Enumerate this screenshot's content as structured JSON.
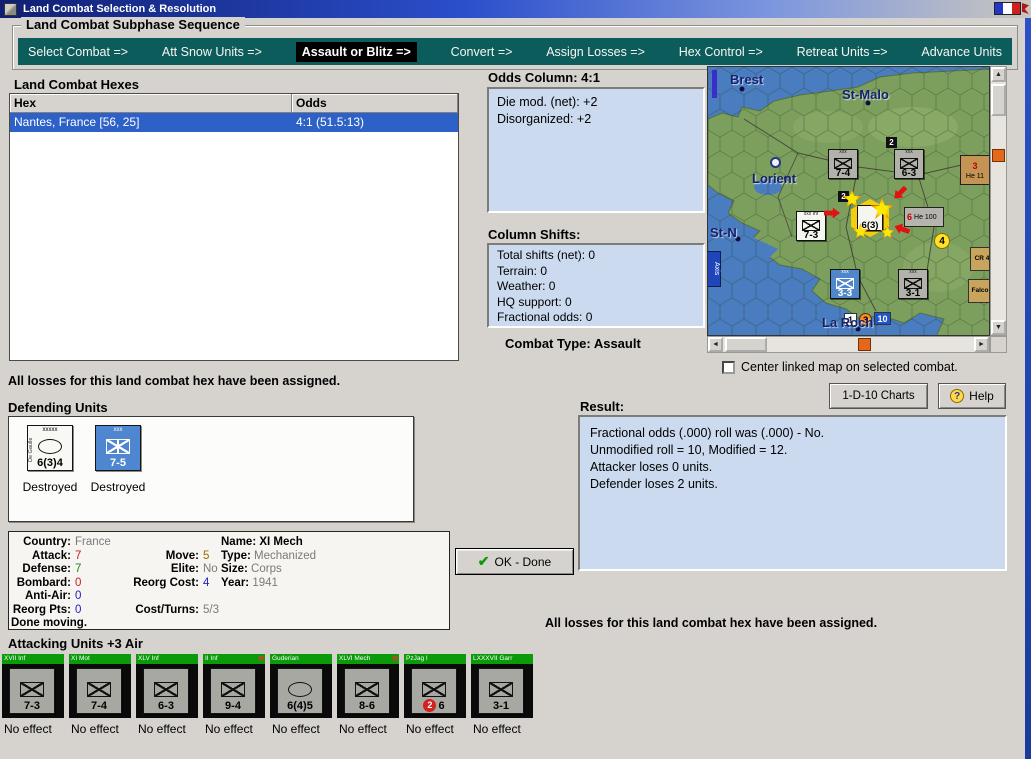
{
  "window": {
    "title": "Land Combat Selection & Resolution"
  },
  "glyphs": {
    "up": "▲",
    "down": "▼",
    "left": "◄",
    "right": "►",
    "help": "?"
  },
  "sequence": {
    "title": "Land Combat Subphase Sequence",
    "steps": [
      "Select Combat =>",
      "Att Snow Units =>",
      "Assault or Blitz =>",
      "Convert =>",
      "Assign Losses =>",
      "Hex Control =>",
      "Retreat Units =>",
      "Advance Units"
    ]
  },
  "hexes": {
    "title": "Land Combat Hexes",
    "col_hex": "Hex",
    "col_odds": "Odds",
    "rows": [
      {
        "hex": "Nantes, France [56, 25]",
        "odds": "4:1 (51.5:13)"
      }
    ]
  },
  "odds_column": {
    "title": "Odds Column: 4:1",
    "lines": [
      "Die mod. (net): +2",
      "Disorganized: +2"
    ]
  },
  "column_shifts": {
    "title": "Column Shifts:",
    "lines": [
      "Total shifts (net): 0",
      "Terrain: 0",
      "Weather: 0",
      "HQ support: 0",
      "Fractional odds: 0"
    ]
  },
  "combat_type": "Combat Type:  Assault",
  "map": {
    "labels": {
      "brest": "Brest",
      "st_malo": "St-Malo",
      "lorient": "Lorient",
      "st_n": "St-N",
      "la_roch": "La Roch"
    },
    "counters": {
      "inf74": "7-4",
      "inf63": "6-3",
      "inf73": "7-3",
      "hq63": "6(3)",
      "inf33": "3-3",
      "inf31": "3-1",
      "size_xxx": "xxx",
      "size_xxx_inf": "xxx Inf",
      "he100_num": "6",
      "he100_label": "He 100",
      "he111_num": "3",
      "he111_label": "He 11",
      "cr4": "CR 4",
      "falco": "Falco",
      "badge2a": "2",
      "badge2b": "2",
      "circle4": "4",
      "marker1": "1",
      "marker3": "3",
      "marker10": "10",
      "axis": "Axis"
    },
    "checkbox_label": "Center linked map on selected combat.",
    "charts_button": "1-D-10 Charts",
    "help_button": "Help"
  },
  "messages": {
    "losses_left": "All losses for this land combat hex have been assigned.",
    "losses_right": "All losses for this land combat hex have been assigned."
  },
  "defending": {
    "title": "Defending Units",
    "units": [
      {
        "name": "De Gaulle",
        "size": "xxxxx",
        "value": "6(3)4",
        "status": "Destroyed"
      },
      {
        "name": "XI Mech",
        "size": "xxx",
        "value": "7-5",
        "status": "Destroyed"
      }
    ]
  },
  "unit_info": {
    "country_label": "Country:",
    "country": "France",
    "attack_label": "Attack:",
    "attack": "7",
    "defense_label": "Defense:",
    "defense": "7",
    "bombard_label": "Bombard:",
    "bombard": "0",
    "antiair_label": "Anti-Air:",
    "antiair": "0",
    "reorgpts_label": "Reorg Pts:",
    "reorgpts": "0",
    "move_label": "Move:",
    "move": "5",
    "elite_label": "Elite:",
    "elite": "No",
    "reorgcost_label": "Reorg Cost:",
    "reorgcost": "4",
    "costturns_label": "Cost/Turns:",
    "costturns": "5/3",
    "name_label": "Name:",
    "name": "XI Mech",
    "type_label": "Type:",
    "type": "Mechanized",
    "size_label": "Size:",
    "size": "Corps",
    "year_label": "Year:",
    "year": "1941",
    "done": "Done moving."
  },
  "result": {
    "title": "Result:",
    "lines": [
      "Fractional odds (.000) roll was (.000)  - No.",
      "Unmodified roll = 10, Modified = 12.",
      "Attacker loses 0 units.",
      "Defender loses 2 units."
    ]
  },
  "ok_button": {
    "label": "OK - Done",
    "check": "✔"
  },
  "attacking": {
    "title": "Attacking Units +3 Air",
    "units": [
      {
        "name": "XVII Inf",
        "value": "7-3",
        "status": "No effect"
      },
      {
        "name": "XI Mot",
        "value": "7-4",
        "status": "No effect"
      },
      {
        "name": "XLV Inf",
        "value": "6-3",
        "status": "No effect"
      },
      {
        "name": "II Inf",
        "value": "9-4",
        "status": "No effect",
        "badge": "R"
      },
      {
        "name": "Guderian",
        "value": "6(4)5",
        "status": "No effect"
      },
      {
        "name": "XLVI Mech",
        "value": "8-6",
        "status": "No effect",
        "badge": "R"
      },
      {
        "name": "PzJag I",
        "circle": "2",
        "value": "6",
        "status": "No effect"
      },
      {
        "name": "LXXXVII Garr",
        "value": "3-1",
        "status": "No effect"
      }
    ]
  }
}
